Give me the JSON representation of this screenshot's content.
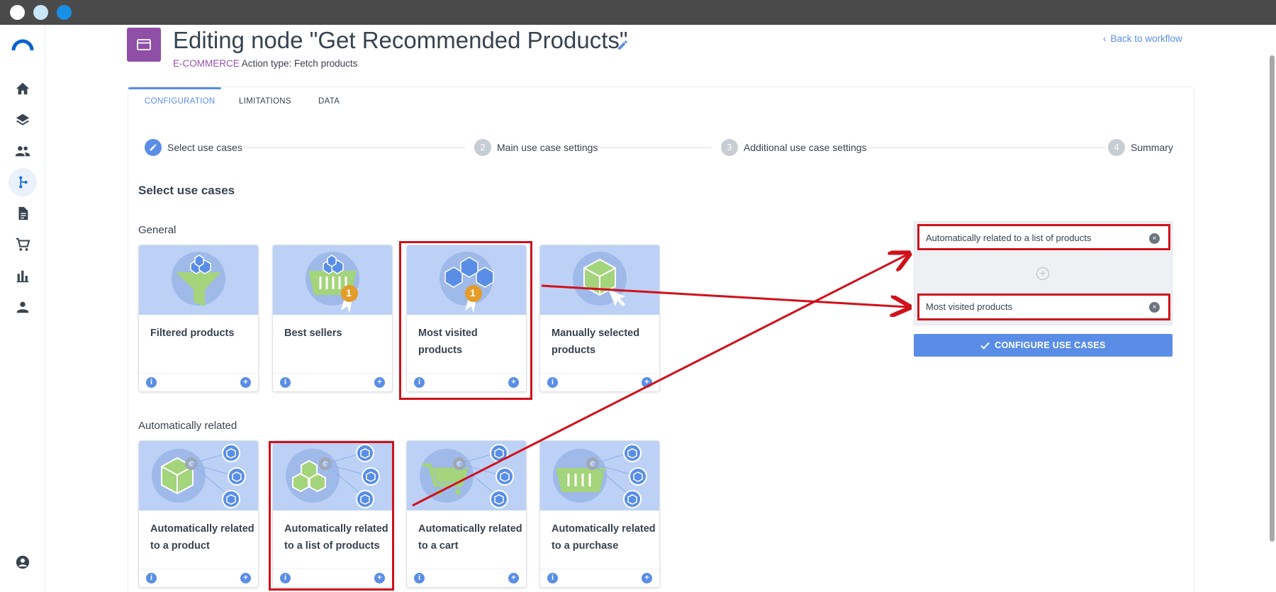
{
  "header": {
    "title": "Editing node \"Get Recommended Products\"",
    "category": "E-COMMERCE",
    "action_type": "Action type: Fetch products",
    "back_label": "Back to workflow"
  },
  "tabs": [
    {
      "label": "CONFIGURATION"
    },
    {
      "label": "LIMITATIONS"
    },
    {
      "label": "DATA"
    }
  ],
  "steps": [
    {
      "label": "Select use cases"
    },
    {
      "number": "2",
      "label": "Main use case settings"
    },
    {
      "number": "3",
      "label": "Additional use case settings"
    },
    {
      "number": "4",
      "label": "Summary"
    }
  ],
  "section_title": "Select use cases",
  "groups": {
    "general": {
      "title": "General",
      "cards": [
        {
          "title": "Filtered products"
        },
        {
          "title": "Best sellers"
        },
        {
          "title": "Most visited products"
        },
        {
          "title": "Manually selected products"
        }
      ]
    },
    "auto": {
      "title": "Automatically related",
      "cards": [
        {
          "title": "Automatically related to a product"
        },
        {
          "title": "Automatically related to a list of products"
        },
        {
          "title": "Automatically related to a cart"
        },
        {
          "title": "Automatically related to a purchase"
        }
      ]
    }
  },
  "selected": [
    {
      "label": "Automatically related to a list of products"
    },
    {
      "label": "Most visited products"
    }
  ],
  "configure_label": "CONFIGURE USE CASES",
  "card_badge": "1",
  "icons": {
    "info": "i",
    "add": "+",
    "remove": "×",
    "add_slot": "+"
  },
  "colors": {
    "accent": "#5a8ee6",
    "category": "#9a4fb0",
    "annotation": "#d0111b",
    "card_image": "#bcd1f5",
    "node_icon": "#8f4fa6"
  }
}
